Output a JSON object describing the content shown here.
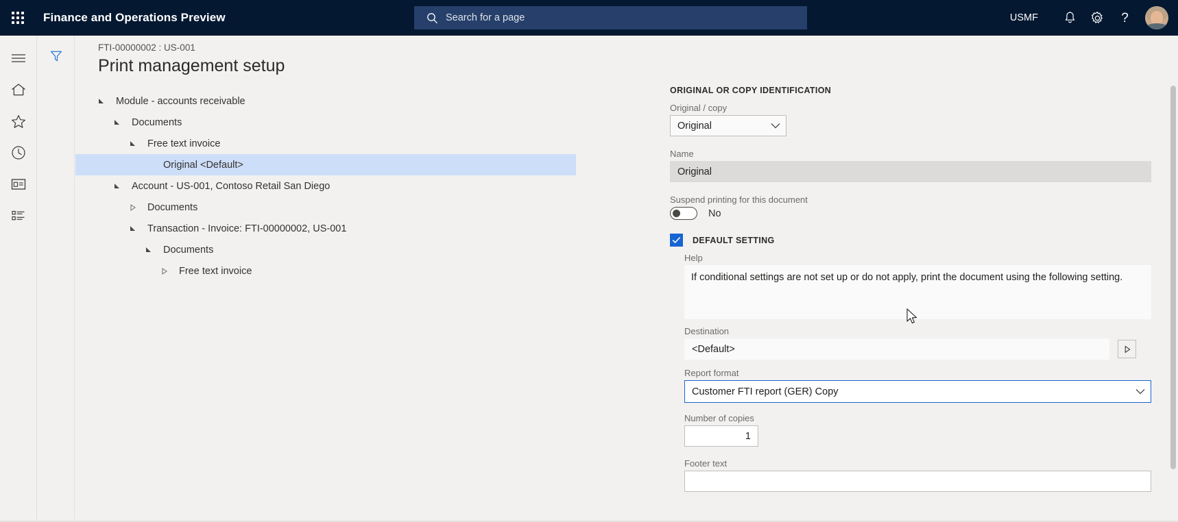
{
  "topbar": {
    "waffle_icon": "app-launcher-icon",
    "app_title": "Finance and Operations Preview",
    "search": {
      "icon": "search-icon",
      "placeholder": "Search for a page",
      "value": ""
    },
    "company": "USMF",
    "icons": [
      "notifications-bell-icon",
      "settings-gear-icon",
      "help-question-icon"
    ],
    "avatar": "user-avatar"
  },
  "left_rail": {
    "items": [
      {
        "icon": "hamburger-menu-icon",
        "name": "expand-navigation"
      },
      {
        "icon": "home-icon",
        "name": "home"
      },
      {
        "icon": "star-icon",
        "name": "favorites"
      },
      {
        "icon": "clock-icon",
        "name": "recent"
      },
      {
        "icon": "workspaces-icon",
        "name": "workspaces"
      },
      {
        "icon": "modules-list-icon",
        "name": "modules"
      }
    ]
  },
  "filter_pane": {
    "icon": "filter-funnel-icon"
  },
  "page": {
    "breadcrumb": "FTI-00000002 : US-001",
    "title": "Print management setup"
  },
  "tree": {
    "nodes": [
      {
        "label": "Module - accounts receivable",
        "depth": 0,
        "state": "expanded",
        "selected": false
      },
      {
        "label": "Documents",
        "depth": 1,
        "state": "expanded",
        "selected": false
      },
      {
        "label": "Free text invoice",
        "depth": 2,
        "state": "expanded",
        "selected": false
      },
      {
        "label": "Original <Default>",
        "depth": 3,
        "state": "leaf",
        "selected": true
      },
      {
        "label": "Account - US-001, Contoso Retail San Diego",
        "depth": 1,
        "state": "expanded",
        "selected": false
      },
      {
        "label": "Documents",
        "depth": 2,
        "state": "collapsed",
        "selected": false
      },
      {
        "label": "Transaction - Invoice: FTI-00000002, US-001",
        "depth": 2,
        "state": "expanded",
        "selected": false
      },
      {
        "label": "Documents",
        "depth": 3,
        "state": "expanded",
        "selected": false
      },
      {
        "label": "Free text invoice",
        "depth": 4,
        "state": "collapsed",
        "selected": false
      }
    ]
  },
  "details": {
    "identification": {
      "section_title": "Original or copy identification",
      "original_copy": {
        "label": "Original / copy",
        "value": "Original",
        "icon": "chevron-down-icon"
      },
      "name": {
        "label": "Name",
        "value": "Original"
      },
      "suspend": {
        "label": "Suspend printing for this document",
        "value": "No",
        "state": "off"
      }
    },
    "default_setting": {
      "section_title": "Default setting",
      "checked": true,
      "help": {
        "label": "Help",
        "text": "If conditional settings are not set up or do not apply, print the document using the following setting."
      },
      "destination": {
        "label": "Destination",
        "value": "<Default>",
        "button_icon": "run-triangle-icon"
      },
      "report_format": {
        "label": "Report format",
        "value": "Customer FTI report (GER) Copy",
        "icon": "chevron-down-icon",
        "focused": true
      },
      "number_of_copies": {
        "label": "Number of copies",
        "value": "1"
      },
      "footer_text": {
        "label": "Footer text",
        "value": ""
      }
    }
  },
  "colors": {
    "nav_background": "#041831",
    "search_background": "#26406b",
    "page_background": "#f2f1f0",
    "accent_blue": "#1764d3",
    "selection_blue": "#cddef8",
    "filter_icon_blue": "#2f7ad3"
  }
}
